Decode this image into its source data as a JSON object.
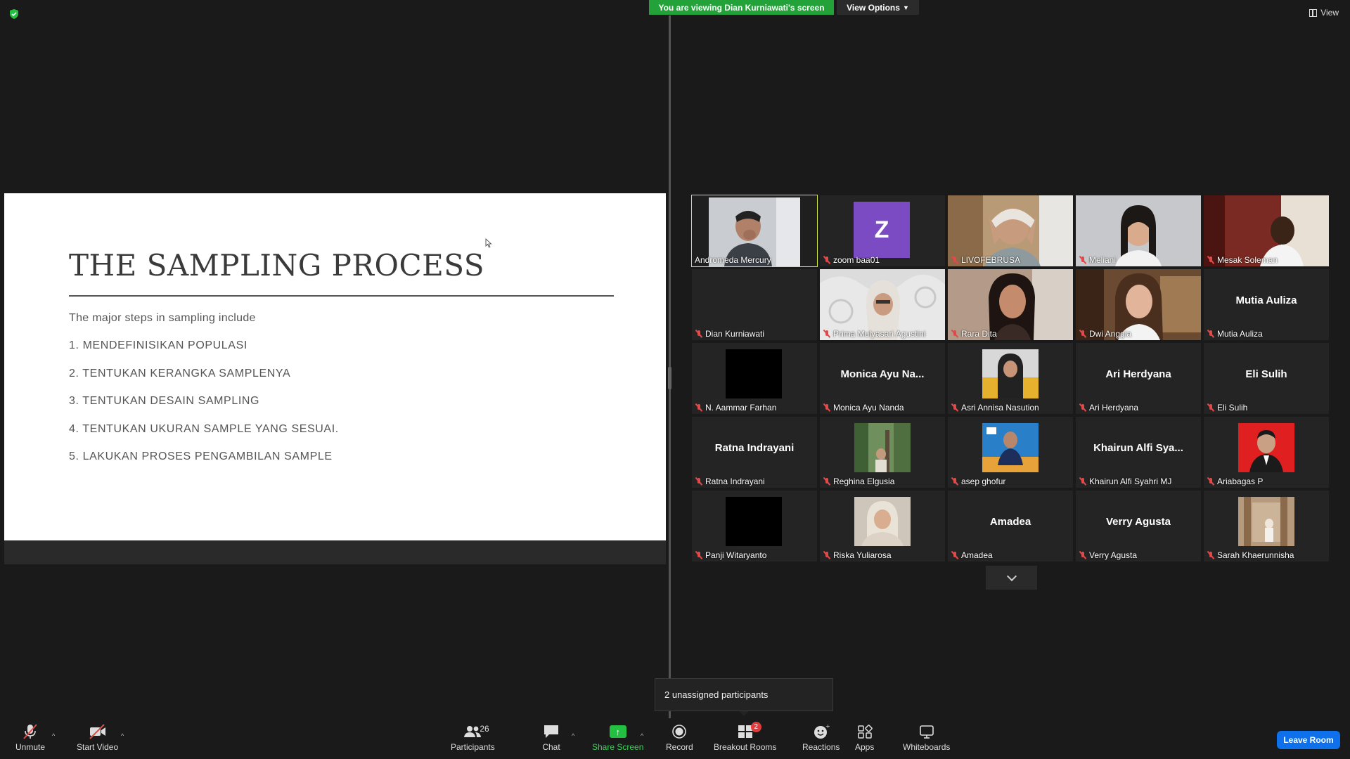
{
  "top": {
    "viewing_banner": "You are viewing Dian Kurniawati's screen",
    "view_options": "View Options",
    "view_label": "View",
    "accent": "#23a23a"
  },
  "slide": {
    "title": "THE SAMPLING PROCESS",
    "intro": "The major steps in sampling include",
    "steps": [
      "1. MENDEFINISIKAN POPULASI",
      "2. TENTUKAN KERANGKA SAMPLENYA",
      "3. TENTUKAN DESAIN SAMPLING",
      "4. TENTUKAN UKURAN SAMPLE YANG SESUAI.",
      "5. LAKUKAN PROSES PENGAMBILAN SAMPLE"
    ]
  },
  "gallery": {
    "tiles": [
      {
        "name": "Andromeda Mercury",
        "muted": false,
        "active": true,
        "kind": "video"
      },
      {
        "name": "zoom baa01",
        "muted": true,
        "kind": "avatar",
        "initial": "Z"
      },
      {
        "name": "LIVOFEBRUSA",
        "muted": true,
        "kind": "video"
      },
      {
        "name": "Meliani",
        "muted": true,
        "kind": "video"
      },
      {
        "name": "Mesak Soleman",
        "muted": true,
        "kind": "video"
      },
      {
        "name": "Dian Kurniawati",
        "muted": true,
        "kind": "empty"
      },
      {
        "name": "Prima Mulyasari Agustini",
        "muted": true,
        "kind": "video"
      },
      {
        "name": "Rara Dita",
        "muted": true,
        "kind": "video"
      },
      {
        "name": "Dwi Anggia",
        "muted": true,
        "kind": "video"
      },
      {
        "name": "Mutia Auliza",
        "muted": true,
        "kind": "name",
        "display": "Mutia Auliza"
      },
      {
        "name": "N. Aammar Farhan",
        "muted": true,
        "kind": "black"
      },
      {
        "name": "Monica Ayu Nanda",
        "muted": true,
        "kind": "name",
        "display": "Monica Ayu Na..."
      },
      {
        "name": "Asri Annisa Nasution",
        "muted": true,
        "kind": "thumb"
      },
      {
        "name": "Ari Herdyana",
        "muted": true,
        "kind": "name",
        "display": "Ari Herdyana"
      },
      {
        "name": "Eli Sulih",
        "muted": true,
        "kind": "name",
        "display": "Eli Sulih"
      },
      {
        "name": "Ratna Indrayani",
        "muted": true,
        "kind": "name",
        "display": "Ratna Indrayani"
      },
      {
        "name": "Reghina Elgusia",
        "muted": true,
        "kind": "thumb"
      },
      {
        "name": "asep ghofur",
        "muted": true,
        "kind": "thumb"
      },
      {
        "name": "Khairun Alfi Syahri MJ",
        "muted": true,
        "kind": "name",
        "display": "Khairun Alfi Sya..."
      },
      {
        "name": "Ariabagas P",
        "muted": true,
        "kind": "thumb"
      },
      {
        "name": "Panji Witaryanto",
        "muted": true,
        "kind": "black"
      },
      {
        "name": "Riska Yuliarosa",
        "muted": true,
        "kind": "thumb"
      },
      {
        "name": "Amadea",
        "muted": true,
        "kind": "name",
        "display": "Amadea"
      },
      {
        "name": "Verry Agusta",
        "muted": true,
        "kind": "name",
        "display": "Verry Agusta"
      },
      {
        "name": "Sarah Khaerunnisha",
        "muted": true,
        "kind": "thumb"
      }
    ]
  },
  "tooltip": "2 unassigned participants",
  "toolbar": {
    "unmute": "Unmute",
    "start_video": "Start Video",
    "participants": "Participants",
    "participants_count": "26",
    "chat": "Chat",
    "share_screen": "Share Screen",
    "record": "Record",
    "breakout_rooms": "Breakout Rooms",
    "breakout_badge": "2",
    "reactions": "Reactions",
    "apps": "Apps",
    "whiteboards": "Whiteboards",
    "leave_room": "Leave Room"
  },
  "icons": {
    "shield": "shield-icon",
    "mic_muted": "mic-muted-icon",
    "video_off": "video-off-icon",
    "participants": "people-icon",
    "chat": "chat-bubble-icon",
    "share": "share-arrow-icon",
    "record": "record-icon",
    "breakout": "grid-icon",
    "reactions": "smiley-icon",
    "apps": "apps-icon",
    "whiteboards": "whiteboard-icon"
  }
}
